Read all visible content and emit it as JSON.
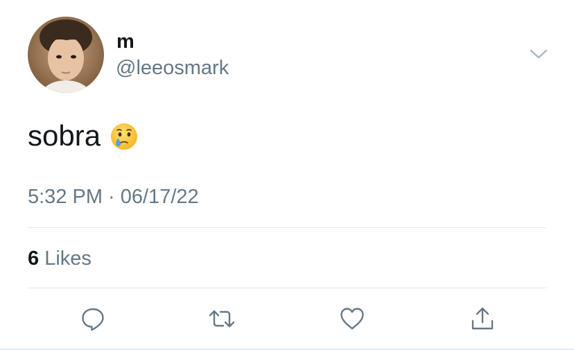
{
  "author": {
    "display_name": "m",
    "handle": "@leeosmark"
  },
  "tweet": {
    "text": "sobra",
    "emoji": "face-holding-back-tears"
  },
  "meta": {
    "timestamp": "5:32 PM · 06/17/22"
  },
  "stats": {
    "likes_count": "6",
    "likes_label": "Likes"
  },
  "actions": [
    "reply",
    "retweet",
    "like",
    "share"
  ],
  "colors": {
    "text": "#14171a",
    "secondary": "#657786",
    "divider": "#e1e8ed",
    "icon": "#657786"
  }
}
